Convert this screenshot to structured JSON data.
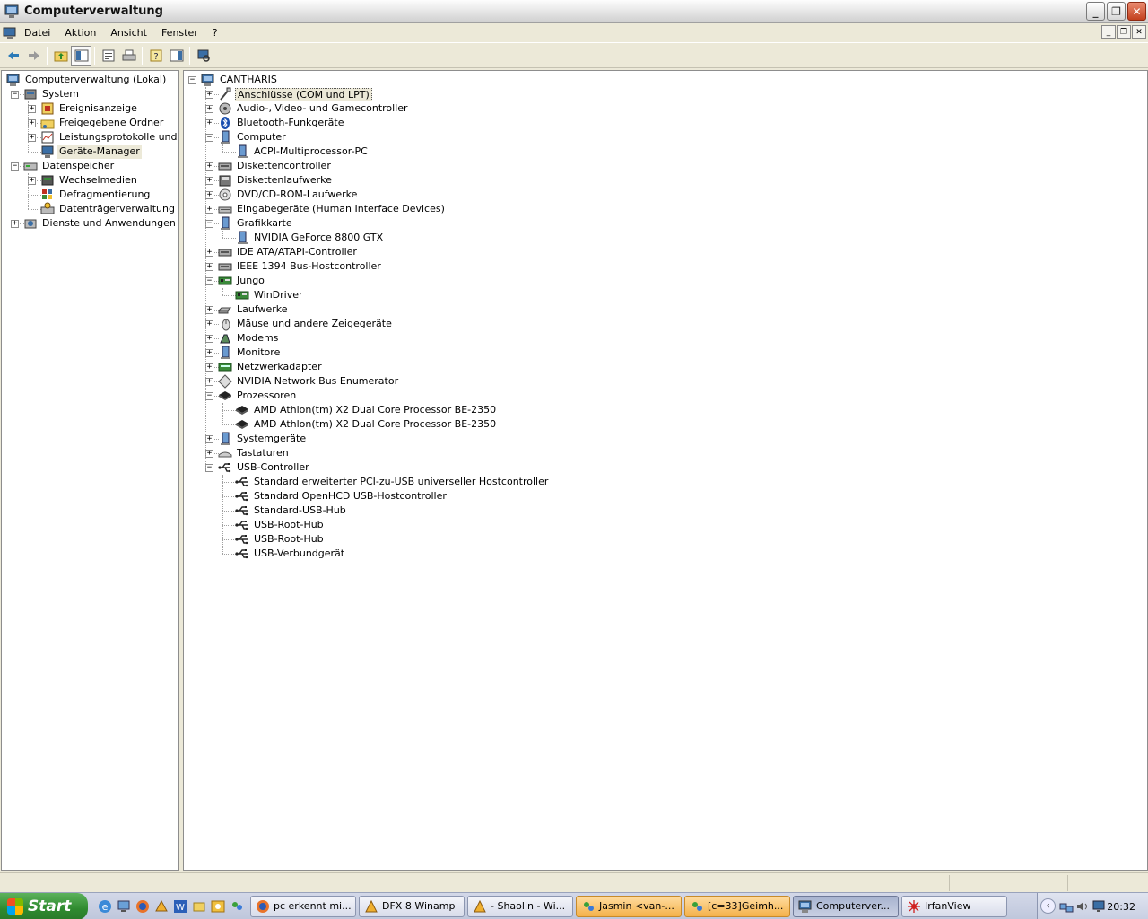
{
  "window": {
    "title": "Computerverwaltung"
  },
  "menu": {
    "items": [
      "Datei",
      "Aktion",
      "Ansicht",
      "Fenster",
      "?"
    ]
  },
  "left_tree": [
    {
      "label": "Computerverwaltung (Lokal)",
      "level": 0,
      "expander": "",
      "icon": "computer-management-icon"
    },
    {
      "label": "System",
      "level": 1,
      "expander": "−",
      "icon": "system-tools-icon"
    },
    {
      "label": "Ereignisanzeige",
      "level": 2,
      "expander": "+",
      "icon": "event-viewer-icon"
    },
    {
      "label": "Freigegebene Ordner",
      "level": 2,
      "expander": "+",
      "icon": "shared-folder-icon"
    },
    {
      "label": "Leistungsprotokolle und Warnungen",
      "level": 2,
      "expander": "+",
      "icon": "performance-logs-icon"
    },
    {
      "label": "Geräte-Manager",
      "level": 2,
      "expander": "",
      "icon": "device-manager-icon",
      "selected": true
    },
    {
      "label": "Datenspeicher",
      "level": 1,
      "expander": "−",
      "icon": "storage-icon"
    },
    {
      "label": "Wechselmedien",
      "level": 2,
      "expander": "+",
      "icon": "removable-storage-icon"
    },
    {
      "label": "Defragmentierung",
      "level": 2,
      "expander": "",
      "icon": "defrag-icon"
    },
    {
      "label": "Datenträgerverwaltung",
      "level": 2,
      "expander": "",
      "icon": "disk-management-icon"
    },
    {
      "label": "Dienste und Anwendungen",
      "level": 1,
      "expander": "+",
      "icon": "services-icon"
    }
  ],
  "device_tree": [
    {
      "label": "CANTHARIS",
      "level": 0,
      "expander": "−",
      "icon": "computer-icon"
    },
    {
      "label": "Anschlüsse (COM und LPT)",
      "level": 1,
      "expander": "+",
      "icon": "port-icon",
      "selected": true
    },
    {
      "label": "Audio-, Video- und Gamecontroller",
      "level": 1,
      "expander": "+",
      "icon": "audio-icon"
    },
    {
      "label": "Bluetooth-Funkgeräte",
      "level": 1,
      "expander": "+",
      "icon": "bluetooth-icon"
    },
    {
      "label": "Computer",
      "level": 1,
      "expander": "−",
      "icon": "pc-icon"
    },
    {
      "label": "ACPI-Multiprocessor-PC",
      "level": 2,
      "expander": "",
      "icon": "pc-icon"
    },
    {
      "label": "Diskettencontroller",
      "level": 1,
      "expander": "+",
      "icon": "floppy-controller-icon"
    },
    {
      "label": "Diskettenlaufwerke",
      "level": 1,
      "expander": "+",
      "icon": "floppy-drive-icon"
    },
    {
      "label": "DVD/CD-ROM-Laufwerke",
      "level": 1,
      "expander": "+",
      "icon": "cdrom-icon"
    },
    {
      "label": "Eingabegeräte (Human Interface Devices)",
      "level": 1,
      "expander": "+",
      "icon": "hid-icon"
    },
    {
      "label": "Grafikkarte",
      "level": 1,
      "expander": "−",
      "icon": "display-adapter-icon"
    },
    {
      "label": "NVIDIA GeForce 8800 GTX",
      "level": 2,
      "expander": "",
      "icon": "display-adapter-icon"
    },
    {
      "label": "IDE ATA/ATAPI-Controller",
      "level": 1,
      "expander": "+",
      "icon": "ide-icon"
    },
    {
      "label": "IEEE 1394 Bus-Hostcontroller",
      "level": 1,
      "expander": "+",
      "icon": "firewire-icon"
    },
    {
      "label": "Jungo",
      "level": 1,
      "expander": "−",
      "icon": "board-icon"
    },
    {
      "label": "WinDriver",
      "level": 2,
      "expander": "",
      "icon": "board-icon"
    },
    {
      "label": "Laufwerke",
      "level": 1,
      "expander": "+",
      "icon": "disk-drive-icon"
    },
    {
      "label": "Mäuse und andere Zeigegeräte",
      "level": 1,
      "expander": "+",
      "icon": "mouse-icon"
    },
    {
      "label": "Modems",
      "level": 1,
      "expander": "+",
      "icon": "modem-icon"
    },
    {
      "label": "Monitore",
      "level": 1,
      "expander": "+",
      "icon": "monitor-icon"
    },
    {
      "label": "Netzwerkadapter",
      "level": 1,
      "expander": "+",
      "icon": "network-adapter-icon"
    },
    {
      "label": "NVIDIA Network Bus Enumerator",
      "level": 1,
      "expander": "+",
      "icon": "bus-enumerator-icon"
    },
    {
      "label": "Prozessoren",
      "level": 1,
      "expander": "−",
      "icon": "processor-icon"
    },
    {
      "label": "AMD Athlon(tm) X2 Dual Core Processor BE-2350",
      "level": 2,
      "expander": "",
      "icon": "processor-icon"
    },
    {
      "label": "AMD Athlon(tm) X2 Dual Core Processor BE-2350",
      "level": 2,
      "expander": "",
      "icon": "processor-icon"
    },
    {
      "label": "Systemgeräte",
      "level": 1,
      "expander": "+",
      "icon": "system-device-icon"
    },
    {
      "label": "Tastaturen",
      "level": 1,
      "expander": "+",
      "icon": "keyboard-icon"
    },
    {
      "label": "USB-Controller",
      "level": 1,
      "expander": "−",
      "icon": "usb-icon"
    },
    {
      "label": "Standard erweiterter PCI-zu-USB universeller Hostcontroller",
      "level": 2,
      "expander": "",
      "icon": "usb-icon"
    },
    {
      "label": "Standard OpenHCD USB-Hostcontroller",
      "level": 2,
      "expander": "",
      "icon": "usb-icon"
    },
    {
      "label": "Standard-USB-Hub",
      "level": 2,
      "expander": "",
      "icon": "usb-icon"
    },
    {
      "label": "USB-Root-Hub",
      "level": 2,
      "expander": "",
      "icon": "usb-icon"
    },
    {
      "label": "USB-Root-Hub",
      "level": 2,
      "expander": "",
      "icon": "usb-icon"
    },
    {
      "label": "USB-Verbundgerät",
      "level": 2,
      "expander": "",
      "icon": "usb-icon"
    }
  ],
  "taskbar": {
    "start_label": "Start",
    "tasks": [
      {
        "label": "pc erkennt mi...",
        "icon": "firefox-icon",
        "style": "normal"
      },
      {
        "label": "DFX 8 Winamp",
        "icon": "winamp-icon",
        "style": "normal"
      },
      {
        "label": "- Shaolin - Wi...",
        "icon": "winamp-icon",
        "style": "normal"
      },
      {
        "label": "Jasmin <van-...",
        "icon": "chat-icon",
        "style": "orange"
      },
      {
        "label": "[c=33]Geimh...",
        "icon": "chat-icon",
        "style": "orange"
      },
      {
        "label": "Computerver...",
        "icon": "computer-management-icon",
        "style": "active"
      },
      {
        "label": "IrfanView",
        "icon": "irfanview-icon",
        "style": "normal"
      }
    ],
    "clock": "20:32"
  },
  "colors": {
    "xp_blue": "#3a6ea5",
    "selection_gray": "#ece9d8",
    "start_green": "#2f8a2f"
  }
}
